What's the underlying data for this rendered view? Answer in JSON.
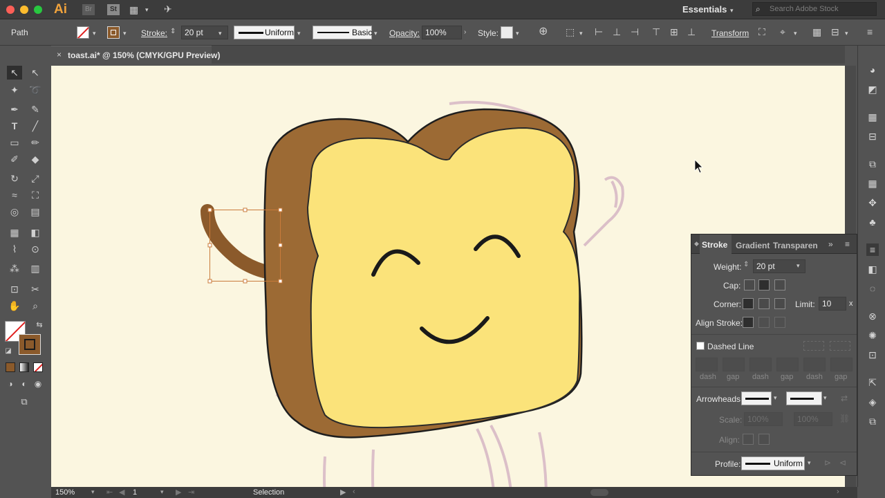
{
  "app": {
    "logo": "Ai",
    "bridge": "Br",
    "stock": "St",
    "workspace": "Essentials",
    "search_placeholder": "Search Adobe Stock"
  },
  "control": {
    "selection_type": "Path",
    "stroke_label": "Stroke:",
    "stroke_value": "20 pt",
    "profile1": "Uniform",
    "profile2": "Basic",
    "opacity_label": "Opacity:",
    "opacity_value": "100%",
    "style_label": "Style:",
    "transform_label": "Transform"
  },
  "document": {
    "tab_title": "toast.ai* @ 150% (CMYK/GPU Preview)",
    "close_glyph": "×"
  },
  "stroke_panel": {
    "tabs": [
      "Stroke",
      "Gradient",
      "Transparen"
    ],
    "weight_label": "Weight:",
    "weight_value": "20 pt",
    "cap_label": "Cap:",
    "corner_label": "Corner:",
    "limit_label": "Limit:",
    "limit_value": "10",
    "limit_unit": "x",
    "align_label": "Align Stroke:",
    "dashed_label": "Dashed Line",
    "dash_labels": [
      "dash",
      "gap",
      "dash",
      "gap",
      "dash",
      "gap"
    ],
    "arrowheads_label": "Arrowheads:",
    "scale_label": "Scale:",
    "scale_values": [
      "100%",
      "100%"
    ],
    "align_arrows_label": "Align:",
    "profile_label": "Profile:",
    "profile_value": "Uniform"
  },
  "status": {
    "zoom": "150%",
    "artboard": "1",
    "tool": "Selection"
  },
  "colors": {
    "fill_brown": "#8b5a2b",
    "toast_yellow": "#fbe37a",
    "crust_brown": "#9c6a34",
    "canvas_bg": "#fbf6e0"
  }
}
